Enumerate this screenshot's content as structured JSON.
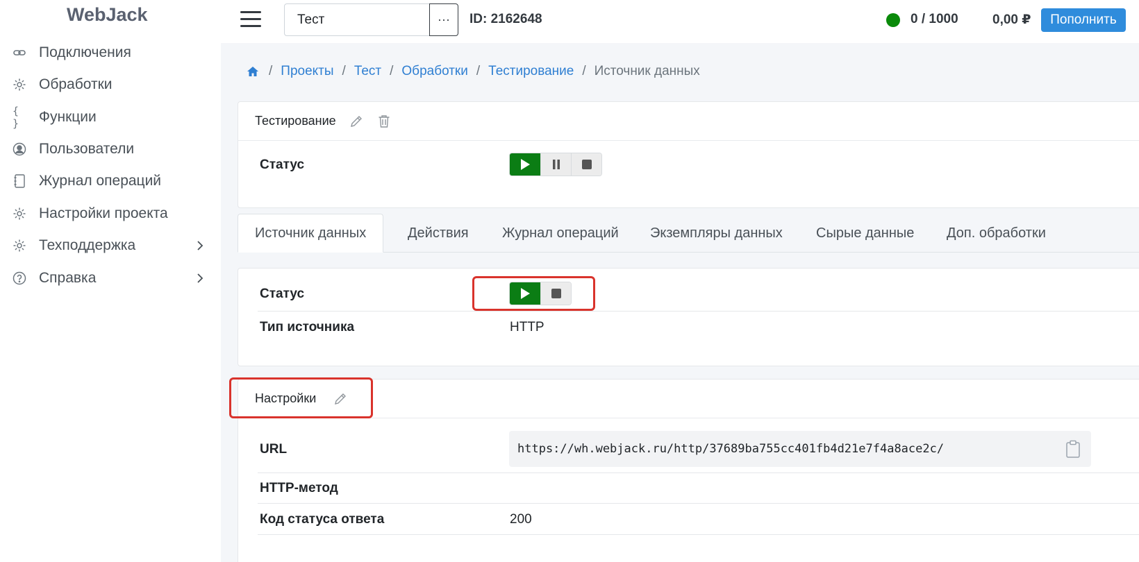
{
  "app": {
    "brand": "WebJack"
  },
  "sidebar": {
    "items": [
      {
        "label": "Подключения",
        "icon": "link-icon"
      },
      {
        "label": "Обработки",
        "icon": "gear-icon"
      },
      {
        "label": "Функции",
        "icon": "braces-icon"
      },
      {
        "label": "Пользователи",
        "icon": "user-circle-icon"
      },
      {
        "label": "Журнал операций",
        "icon": "journal-icon"
      },
      {
        "label": "Настройки проекта",
        "icon": "gear-icon"
      },
      {
        "label": "Техподдержка",
        "icon": "gear-icon",
        "expandable": true
      },
      {
        "label": "Справка",
        "icon": "question-circle-icon",
        "expandable": true
      }
    ]
  },
  "topbar": {
    "project_name": "Тест",
    "more_label": "···",
    "project_id": "ID: 2162648",
    "quota": "0 / 1000",
    "status_color": "#0a8a0a",
    "balance": "0,00 ₽",
    "topup_label": "Пополнить"
  },
  "breadcrumb": {
    "items": [
      "Проекты",
      "Тест",
      "Обработки",
      "Тестирование"
    ],
    "current": "Источник данных"
  },
  "processing_card": {
    "title": "Тестирование",
    "status_label": "Статус"
  },
  "tabs": [
    {
      "label": "Источник данных",
      "active": true
    },
    {
      "label": "Действия"
    },
    {
      "label": "Журнал операций"
    },
    {
      "label": "Экземпляры данных"
    },
    {
      "label": "Сырые данные"
    },
    {
      "label": "Доп. обработки"
    }
  ],
  "source_card": {
    "status_label": "Статус",
    "type_label": "Тип источника",
    "type_value": "HTTP"
  },
  "settings_card": {
    "title": "Настройки",
    "url_label": "URL",
    "url_value": "https://wh.webjack.ru/http/37689ba755cc401fb4d21e7f4a8ace2c/",
    "method_label": "HTTP-метод",
    "method_value": "",
    "status_code_label": "Код статуса ответа",
    "status_code_value": "200"
  },
  "colors": {
    "accent": "#2f8cdc",
    "link": "#2f7fd2",
    "play": "#0b7d14",
    "highlight": "#d9332c"
  }
}
